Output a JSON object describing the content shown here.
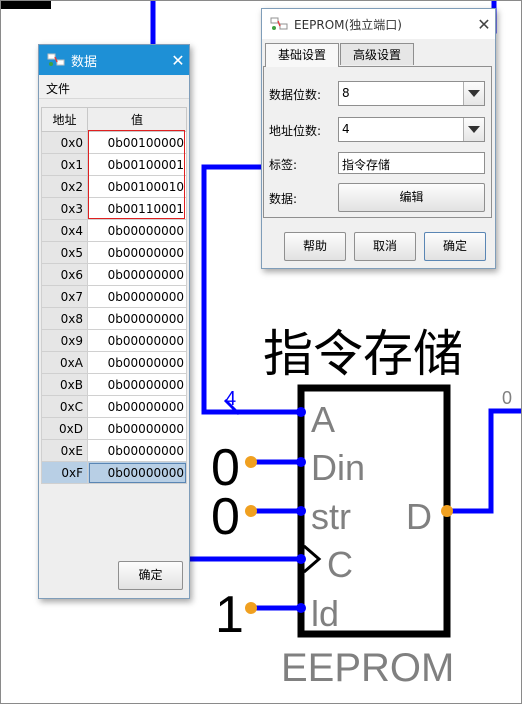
{
  "circuit": {
    "component_label": "指令存储",
    "component_type": "EEPROM",
    "bus_width_label": "4",
    "output_label_partial": "0",
    "pins": {
      "a": "A",
      "din": "Din",
      "str": "str",
      "c": "C",
      "ld": "ld",
      "d": "D"
    },
    "const_din": "0",
    "const_str": "0",
    "const_ld": "1",
    "colors": {
      "wire": "#0000ff",
      "pin_dot": "#f0a020",
      "body": "#000000",
      "pin_text": "#808080"
    }
  },
  "data_dialog": {
    "title": "数据",
    "title_icon": "app-circuit-icon",
    "close_icon": "close-icon",
    "menu": {
      "file": "文件"
    },
    "table": {
      "headers": [
        "地址",
        "值"
      ],
      "rows": [
        {
          "addr": "0x0",
          "val": "0b00100000"
        },
        {
          "addr": "0x1",
          "val": "0b00100001"
        },
        {
          "addr": "0x2",
          "val": "0b00100010"
        },
        {
          "addr": "0x3",
          "val": "0b00110001"
        },
        {
          "addr": "0x4",
          "val": "0b00000000"
        },
        {
          "addr": "0x5",
          "val": "0b00000000"
        },
        {
          "addr": "0x6",
          "val": "0b00000000"
        },
        {
          "addr": "0x7",
          "val": "0b00000000"
        },
        {
          "addr": "0x8",
          "val": "0b00000000"
        },
        {
          "addr": "0x9",
          "val": "0b00000000"
        },
        {
          "addr": "0xA",
          "val": "0b00000000"
        },
        {
          "addr": "0xB",
          "val": "0b00000000"
        },
        {
          "addr": "0xC",
          "val": "0b00000000"
        },
        {
          "addr": "0xD",
          "val": "0b00000000"
        },
        {
          "addr": "0xE",
          "val": "0b00000000"
        },
        {
          "addr": "0xF",
          "val": "0b00000000"
        }
      ],
      "selected_row": 15
    },
    "ok_label": "确定",
    "highlight_color": "#e02020",
    "title_color": "#1e90d6"
  },
  "eeprom_dialog": {
    "title": "EEPROM(独立端口)",
    "title_icon": "app-circuit-icon",
    "close_icon": "close-icon",
    "tabs": [
      "基础设置",
      "高级设置"
    ],
    "active_tab": 0,
    "fields": {
      "data_bits": {
        "label": "数据位数:",
        "value": "8"
      },
      "addr_bits": {
        "label": "地址位数:",
        "value": "4"
      },
      "tag": {
        "label": "标签:",
        "value": "指令存储"
      },
      "data": {
        "label": "数据:",
        "button": "编辑"
      }
    },
    "buttons": {
      "help": "帮助",
      "cancel": "取消",
      "ok": "确定"
    }
  }
}
